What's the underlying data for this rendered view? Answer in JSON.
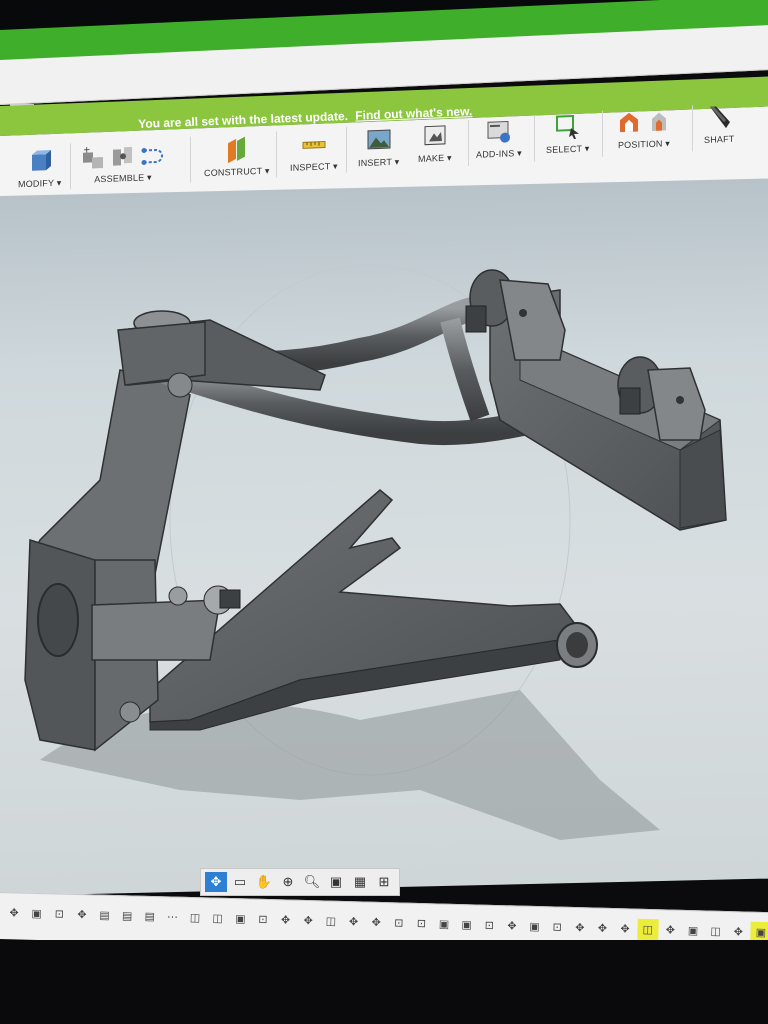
{
  "window": {
    "close_glyph": "×"
  },
  "banner": {
    "message": "You are all set with the latest update.",
    "link": "Find out what's new."
  },
  "toolbar": {
    "groups": [
      {
        "label": "MODIFY",
        "icons": [
          "press-pull-icon"
        ]
      },
      {
        "label": "ASSEMBLE",
        "icons": [
          "new-component-icon",
          "joint-icon",
          "motion-link-icon"
        ]
      },
      {
        "label": "CONSTRUCT",
        "icons": [
          "offset-plane-icon"
        ]
      },
      {
        "label": "INSPECT",
        "icons": [
          "measure-icon"
        ]
      },
      {
        "label": "INSERT",
        "icons": [
          "insert-image-icon"
        ]
      },
      {
        "label": "MAKE",
        "icons": [
          "3d-print-icon"
        ]
      },
      {
        "label": "ADD-INS",
        "icons": [
          "scripts-icon"
        ]
      },
      {
        "label": "SELECT",
        "icons": [
          "select-box-icon"
        ]
      },
      {
        "label": "POSITION",
        "icons": [
          "capture-position-icon",
          "revert-position-icon"
        ]
      },
      {
        "label": "SHAFT",
        "icons": [
          "shaft-icon"
        ]
      }
    ],
    "dropdown_glyph": "▾"
  },
  "nav": {
    "items": [
      "orbit-icon",
      "look-at-icon",
      "pan-icon",
      "zoom-icon",
      "zoom-window-icon",
      "display-settings-icon",
      "grid-icon",
      "viewports-icon"
    ]
  },
  "timeline": {
    "count": 34,
    "highlighted": [
      28,
      33
    ]
  },
  "colors": {
    "banner": "#8cc63f",
    "top_bar": "#3fae2a",
    "accent": "#2d7fd3",
    "part": "#5f6264",
    "highlight": "#ecec3a"
  }
}
